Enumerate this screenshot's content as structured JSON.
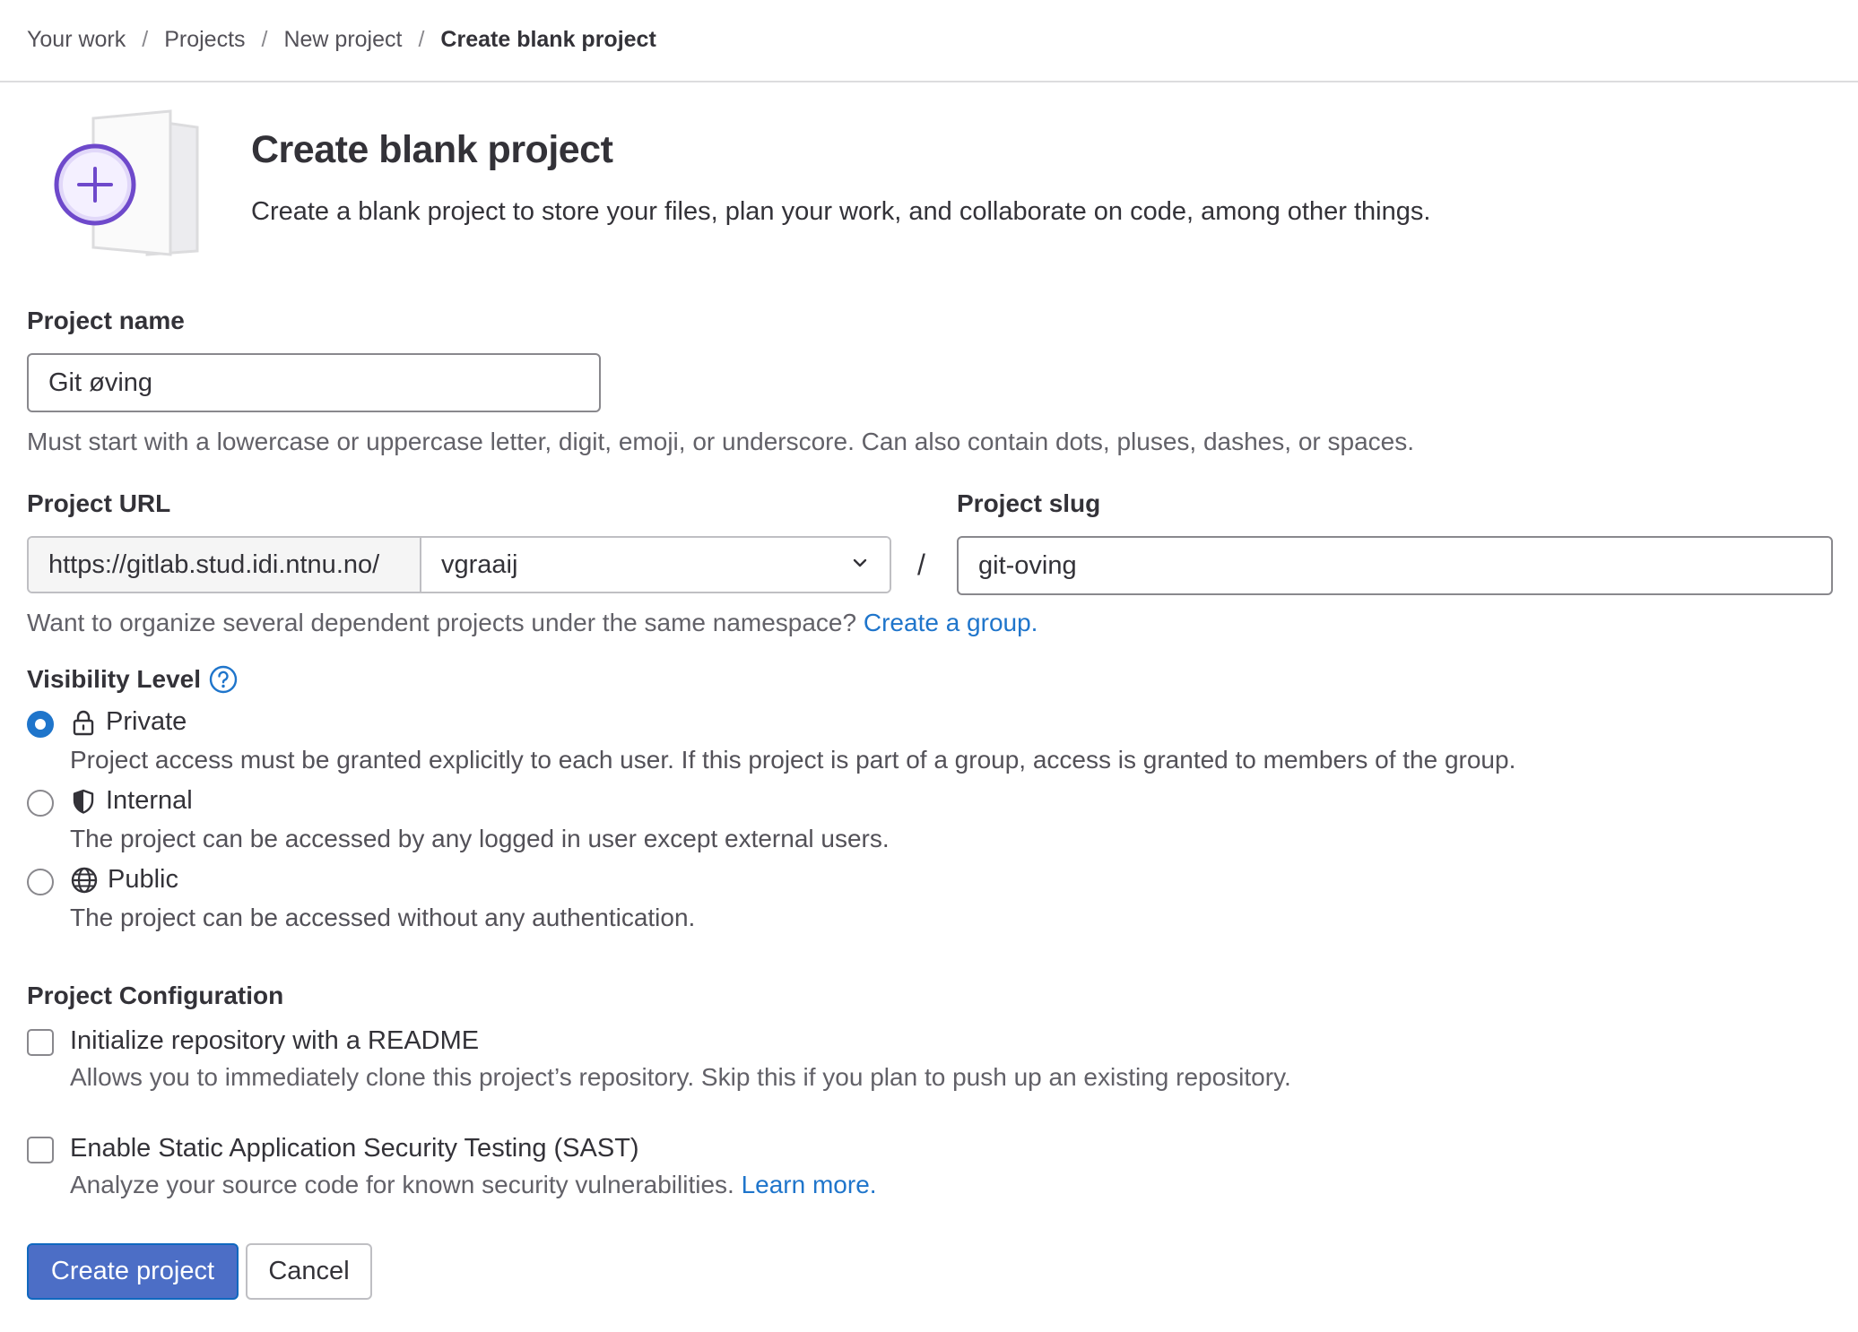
{
  "breadcrumb": {
    "items": [
      "Your work",
      "Projects",
      "New project"
    ],
    "separator": "/",
    "current": "Create blank project"
  },
  "header": {
    "title": "Create blank project",
    "subtitle": "Create a blank project to store your files, plan your work, and collaborate on code, among other things."
  },
  "project_name": {
    "label": "Project name",
    "value": "Git øving",
    "help": "Must start with a lowercase or uppercase letter, digit, emoji, or underscore. Can also contain dots, pluses, dashes, or spaces."
  },
  "project_url": {
    "label": "Project URL",
    "prefix": "https://gitlab.stud.idi.ntnu.no/",
    "namespace": "vgraaij",
    "separator": "/",
    "help": "Want to organize several dependent projects under the same namespace?",
    "help_link": "Create a group."
  },
  "project_slug": {
    "label": "Project slug",
    "value": "git-oving"
  },
  "visibility": {
    "label": "Visibility Level",
    "help_icon": "question-circle-icon",
    "selected": "Private",
    "options": [
      {
        "label": "Private",
        "icon": "lock-icon",
        "description": "Project access must be granted explicitly to each user. If this project is part of a group, access is granted to members of the group."
      },
      {
        "label": "Internal",
        "icon": "shield-icon",
        "description": "The project can be accessed by any logged in user except external users."
      },
      {
        "label": "Public",
        "icon": "globe-icon",
        "description": "The project can be accessed without any authentication."
      }
    ]
  },
  "configuration": {
    "label": "Project Configuration",
    "readme": {
      "label": "Initialize repository with a README",
      "description": "Allows you to immediately clone this project’s repository. Skip this if you plan to push up an existing repository.",
      "checked": false
    },
    "sast": {
      "label": "Enable Static Application Security Testing (SAST)",
      "description": "Analyze your source code for known security vulnerabilities.",
      "link": "Learn more.",
      "checked": false
    }
  },
  "actions": {
    "create": "Create project",
    "cancel": "Cancel"
  },
  "colors": {
    "primary": "#1f75cb",
    "link": "#1f75cb",
    "illustration_accent": "#6e49cb"
  }
}
